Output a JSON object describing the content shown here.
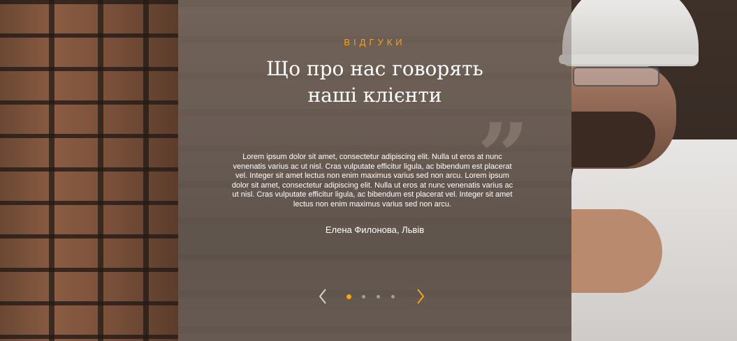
{
  "section": {
    "eyebrow": "ВІДГУКИ",
    "title_line1": "Що про нас говорять",
    "title_line2": "наші клієнти",
    "quote_mark": "”"
  },
  "testimonial": {
    "text": "Lorem ipsum dolor sit amet, consectetur adipiscing elit. Nulla ut eros at nunc venenatis varius ac ut nisl. Cras vulputate efficitur ligula, ac bibendum est placerat vel. Integer sit amet lectus non enim maximus varius sed non arcu. Lorem ipsum dolor sit amet, consectetur adipiscing elit. Nulla ut eros at nunc venenatis varius ac ut nisl. Cras vulputate efficitur ligula, ac bibendum est placerat vel. Integer sit amet lectus non enim maximus varius sed non arcu.",
    "author": "Елена Филонова, Львів"
  },
  "slider": {
    "total_slides": 4,
    "active_slide": 1,
    "prev_icon": "chevron-left-icon",
    "next_icon": "chevron-right-icon"
  },
  "colors": {
    "accent": "#f2a51f",
    "text": "#ffffff"
  }
}
